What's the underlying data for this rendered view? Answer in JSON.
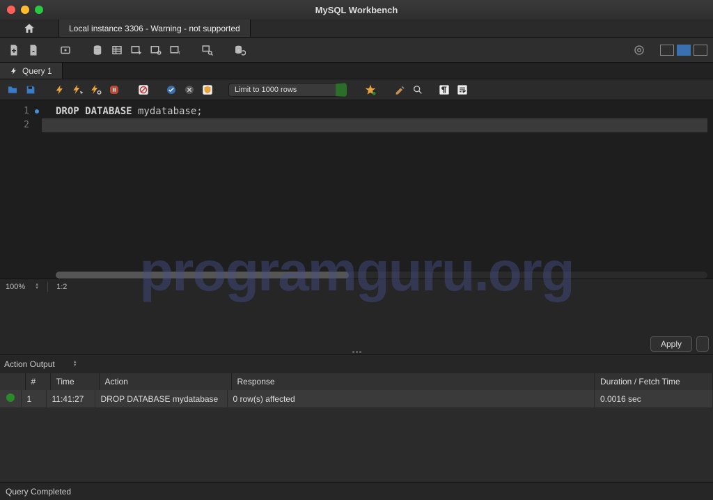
{
  "window": {
    "title": "MySQL Workbench"
  },
  "connection_tab": {
    "label": "Local instance 3306 - Warning - not supported"
  },
  "query_tab": {
    "label": "Query 1"
  },
  "query_toolbar": {
    "limit_label": "Limit to 1000 rows"
  },
  "editor": {
    "lines": [
      {
        "num": "1",
        "kw": "DROP DATABASE",
        "ident": " mydatabase",
        "punct": ";",
        "marker": true
      },
      {
        "num": "2",
        "kw": "",
        "ident": "",
        "punct": "",
        "marker": false
      }
    ],
    "zoom": "100%",
    "cursor": "1:2"
  },
  "apply": {
    "label": "Apply"
  },
  "output": {
    "mode": "Action Output",
    "columns": {
      "idx": "#",
      "time": "Time",
      "action": "Action",
      "response": "Response",
      "duration": "Duration / Fetch Time"
    },
    "rows": [
      {
        "status": "ok",
        "idx": "1",
        "time": "11:41:27",
        "action": "DROP DATABASE mydatabase",
        "response": "0 row(s) affected",
        "duration": "0.0016 sec"
      }
    ]
  },
  "statusbar": {
    "text": "Query Completed"
  },
  "watermark": "programguru.org"
}
